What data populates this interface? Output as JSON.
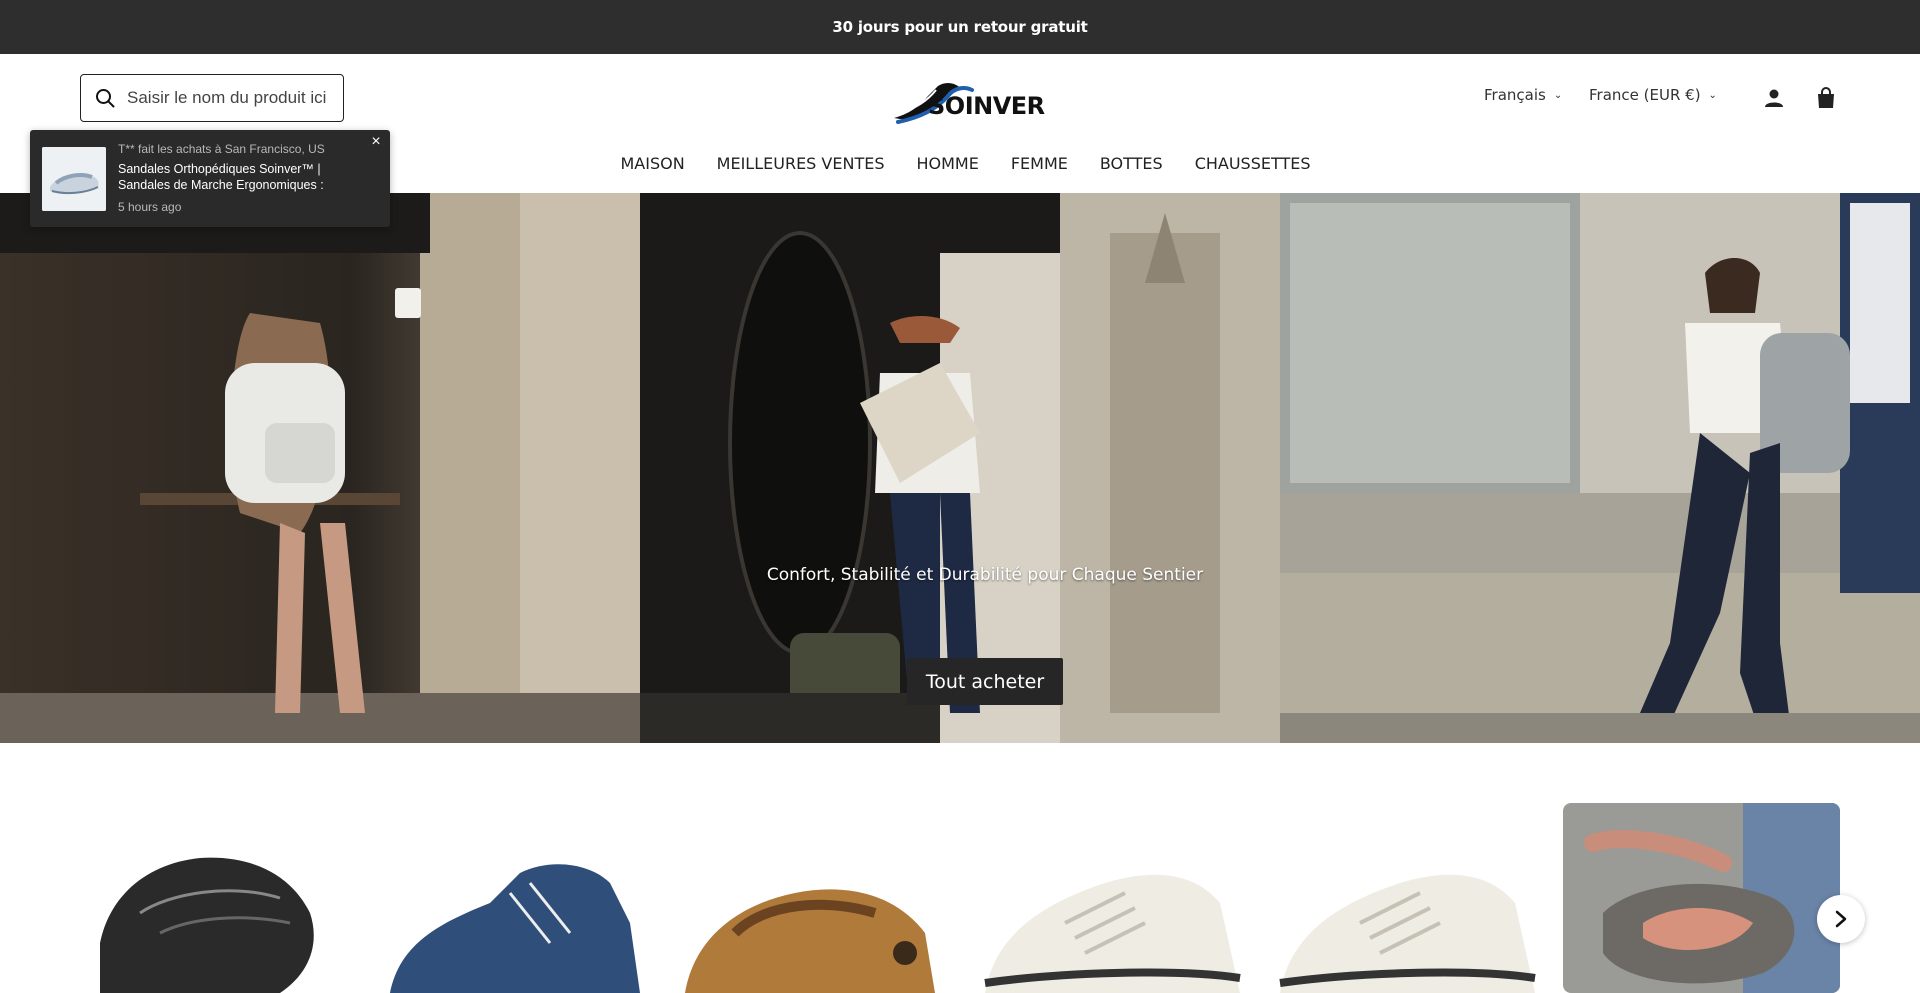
{
  "announcement": {
    "text": "30 jours pour un retour gratuit"
  },
  "header": {
    "search": {
      "placeholder": "Saisir le nom du produit ici e"
    },
    "logo_text": "SOINVER",
    "language": {
      "selected": "Français"
    },
    "region": {
      "selected": "France (EUR €)"
    },
    "icons": [
      "account-icon",
      "cart-icon",
      "search-icon"
    ]
  },
  "nav": {
    "items": [
      {
        "label": "MAISON"
      },
      {
        "label": "MEILLEURES VENTES"
      },
      {
        "label": "HOMME"
      },
      {
        "label": "FEMME"
      },
      {
        "label": "BOTTES"
      },
      {
        "label": "CHAUSSETTES"
      }
    ]
  },
  "toast": {
    "meta": "T** fait les achats à San Francisco, US",
    "product": "Sandales Orthopédiques Soinver™ | Sandales de Marche Ergonomiques : Marchez sur un…",
    "time": "5 hours ago"
  },
  "hero": {
    "caption": "Confort, Stabilité et Durabilité pour Chaque Sentier",
    "button_label": "Tout acheter"
  },
  "colors": {
    "announce_bg": "#2e2e2e",
    "button_bg": "#262626",
    "logo_accent": "#1f5fae"
  }
}
